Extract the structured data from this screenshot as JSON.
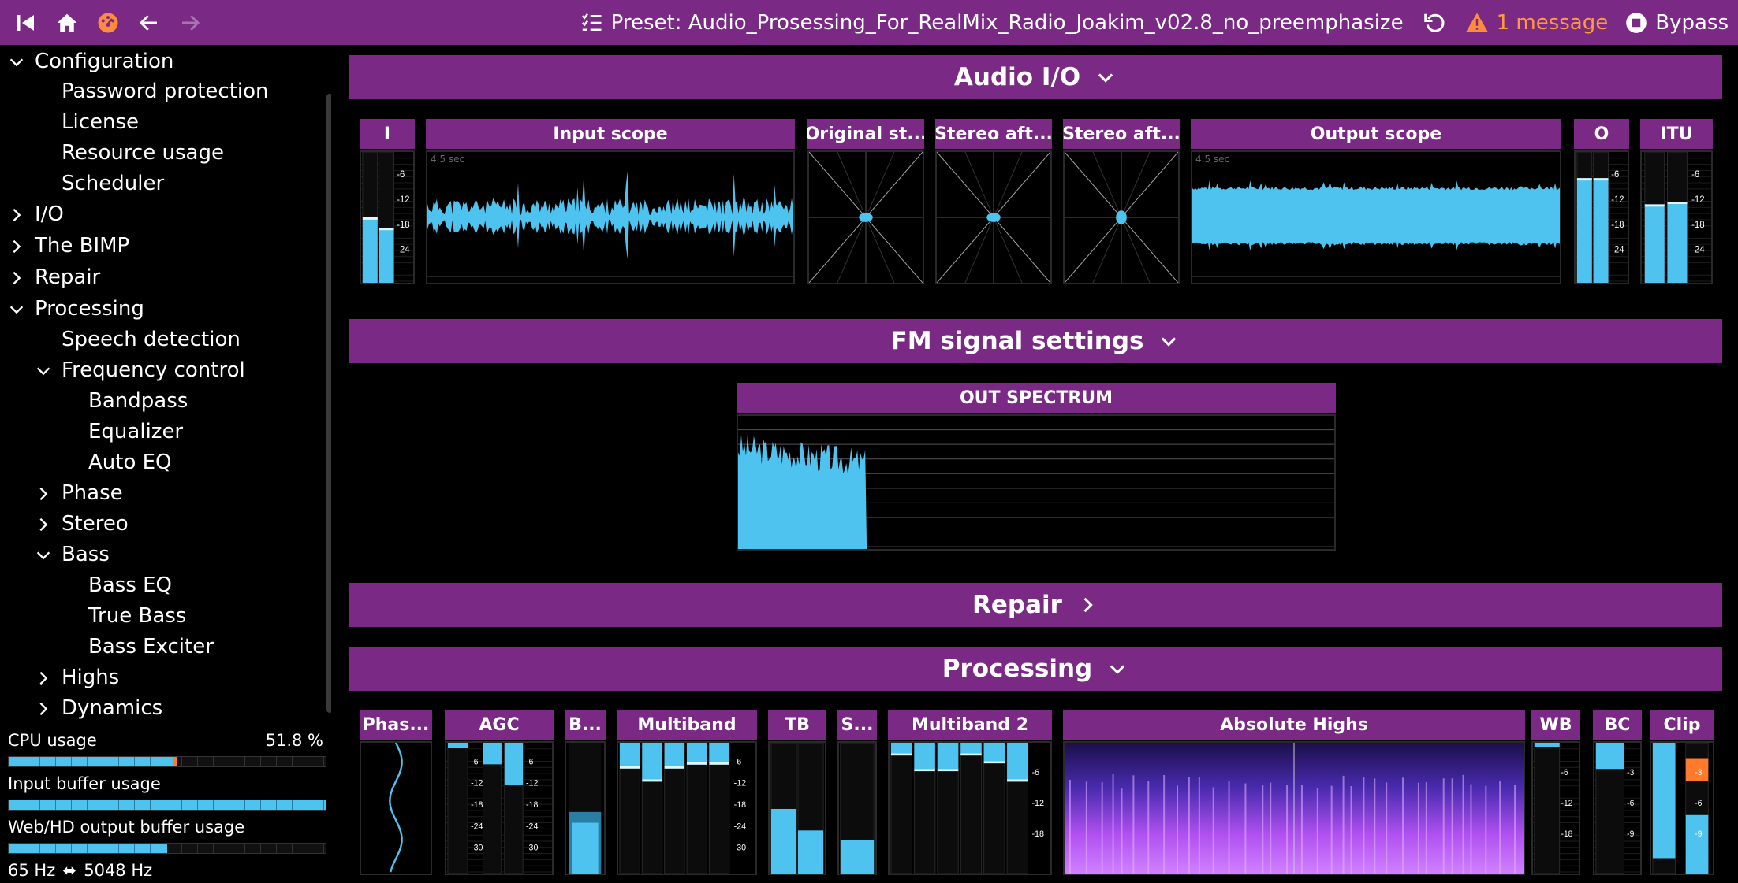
{
  "topbar": {
    "icons": [
      "first-page-icon",
      "home-icon",
      "gauge-icon",
      "back-arrow-icon",
      "forward-arrow-icon"
    ],
    "preset_label": "Preset: Audio_Prosessing_For_RealMix_Radio_Joakim_v02.8_no_preemphasize",
    "warning_label": "1 message",
    "bypass_label": "Bypass"
  },
  "sidebar": {
    "items": [
      {
        "label": "Configuration",
        "chevron": "down"
      },
      {
        "label": "Password protection",
        "chevron": ""
      },
      {
        "label": "License",
        "chevron": ""
      },
      {
        "label": "Resource usage",
        "chevron": ""
      },
      {
        "label": "Scheduler",
        "chevron": ""
      },
      {
        "label": "I/O",
        "chevron": "right"
      },
      {
        "label": "The BIMP",
        "chevron": "right"
      },
      {
        "label": "Repair",
        "chevron": "right"
      },
      {
        "label": "Processing",
        "chevron": "down"
      },
      {
        "label": "Speech detection",
        "chevron": ""
      },
      {
        "label": "Frequency control",
        "chevron": "down"
      },
      {
        "label": "Bandpass",
        "chevron": ""
      },
      {
        "label": "Equalizer",
        "chevron": ""
      },
      {
        "label": "Auto EQ",
        "chevron": ""
      },
      {
        "label": "Phase",
        "chevron": "right"
      },
      {
        "label": "Stereo",
        "chevron": "right"
      },
      {
        "label": "Bass",
        "chevron": "down"
      },
      {
        "label": "Bass EQ",
        "chevron": ""
      },
      {
        "label": "True Bass",
        "chevron": ""
      },
      {
        "label": "Bass Exciter",
        "chevron": ""
      },
      {
        "label": "Highs",
        "chevron": "right"
      },
      {
        "label": "Dynamics",
        "chevron": "right"
      }
    ]
  },
  "stats": {
    "cpu_label": "CPU usage",
    "cpu_value": "51.8 %",
    "cpu_fraction": 0.518,
    "input_label": "Input buffer usage",
    "input_fraction": 1.0,
    "output_label": "Web/HD output buffer usage",
    "output_fraction": 0.5,
    "freq_low": "65 Hz",
    "freq_high": "5048 Hz"
  },
  "sections": {
    "audio_io": "Audio I/O",
    "fm": "FM signal settings",
    "repair": "Repair",
    "processing": "Processing"
  },
  "audio_panels": {
    "in_meter": "I",
    "input_scope": "Input scope",
    "original_stereo": "Original st...",
    "stereo_after_1": "Stereo aft...",
    "stereo_after_2": "Stereo aft...",
    "output_scope": "Output scope",
    "out_meter": "O",
    "itu": "ITU",
    "scope_time": "4.5 sec",
    "meter_ticks": [
      "-6",
      "-12",
      "-18",
      "-24"
    ]
  },
  "fm_panel": {
    "title": "OUT SPECTRUM"
  },
  "proc_panels": {
    "phase": "Phas...",
    "agc": "AGC",
    "b": "B...",
    "multiband": "Multiband",
    "tb": "TB",
    "s": "S...",
    "multiband2": "Multiband 2",
    "absolute_highs": "Absolute Highs",
    "wb": "WB",
    "bc": "BC",
    "clip": "Clip",
    "ticks_30": [
      "-6",
      "-12",
      "-18",
      "-24",
      "-30"
    ],
    "ticks_18": [
      "-6",
      "-12",
      "-18"
    ],
    "ticks_9": [
      "-3",
      "-6",
      "-9"
    ]
  },
  "colors": {
    "accent": "#7a2a84",
    "meter": "#4fc3f0",
    "warning": "#ff9a3c",
    "clip": "#ff7a2a"
  }
}
